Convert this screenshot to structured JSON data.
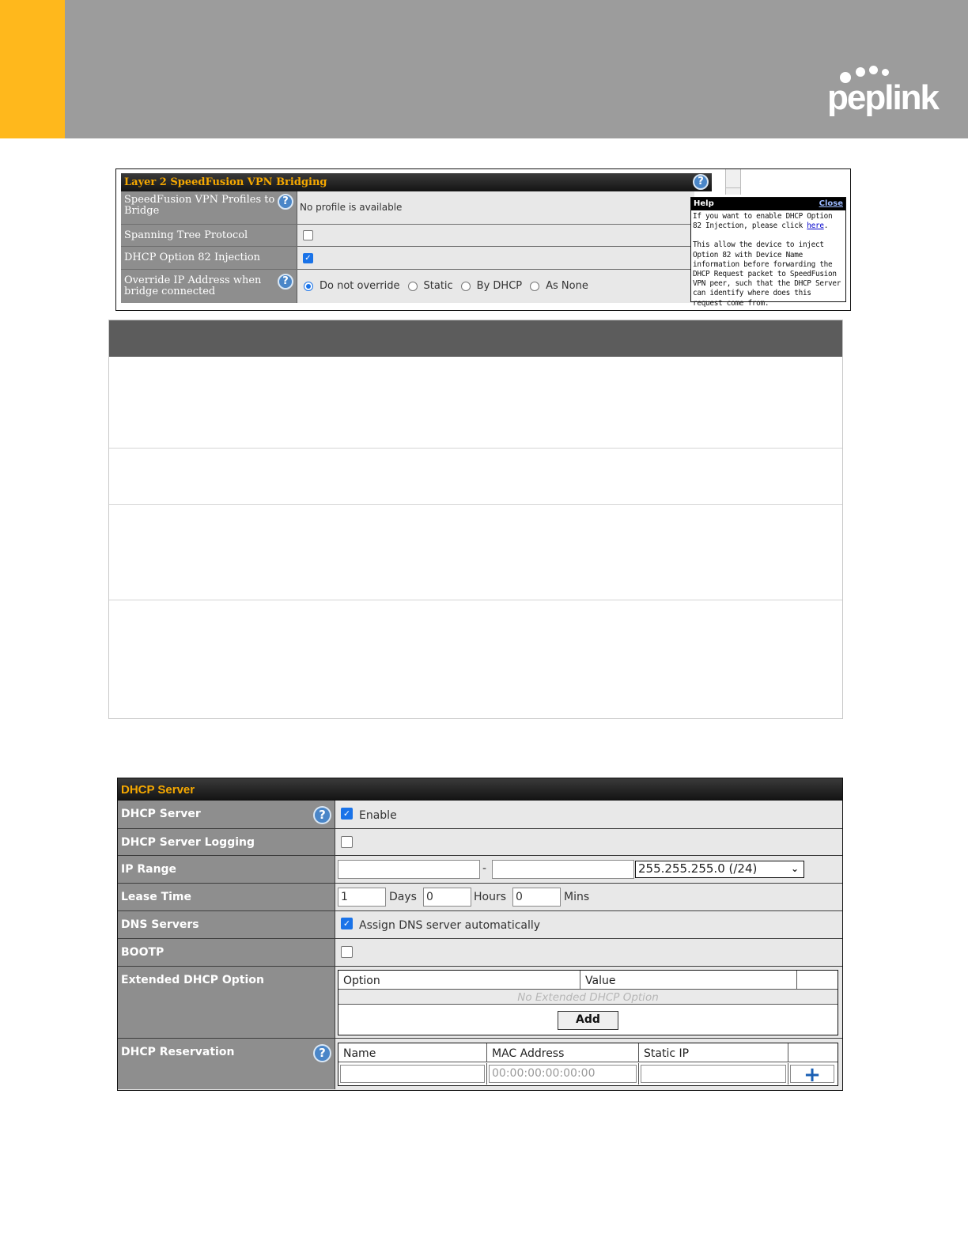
{
  "brand": {
    "logo_text": "peplink",
    "accent_color": "#ffb81c",
    "band_color": "#9c9c9c"
  },
  "l2_bridging": {
    "title": "Layer 2 SpeedFusion VPN Bridging",
    "rows": [
      {
        "label": "SpeedFusion VPN Profiles to Bridge",
        "value": "No profile is available",
        "has_help": true
      },
      {
        "label": "Spanning Tree Protocol",
        "checked": false
      },
      {
        "label": "DHCP Option 82 Injection",
        "checked": true
      },
      {
        "label": "Override IP Address when bridge connected",
        "has_help": true
      }
    ],
    "override_options": [
      {
        "label": "Do not override",
        "selected": true
      },
      {
        "label": "Static",
        "selected": false
      },
      {
        "label": "By DHCP",
        "selected": false
      },
      {
        "label": "As None",
        "selected": false
      }
    ],
    "help": {
      "title": "Help",
      "close": "Close",
      "para1_before": "If you want to enable DHCP Option 82 Injection, please click ",
      "para1_link": "here",
      "para1_after": ".",
      "para2": "This allow the device to inject Option 82 with Device Name information before forwarding the DHCP Request packet to SpeedFusion VPN peer, such that the DHCP Server can identify where does this request come from."
    }
  },
  "dhcp_server": {
    "title": "DHCP Server",
    "server": {
      "label": "DHCP Server",
      "checked": true,
      "text": "Enable"
    },
    "logging": {
      "label": "DHCP Server Logging",
      "checked": false
    },
    "ip_range": {
      "label": "IP Range",
      "start": "",
      "end": "",
      "separator": "-",
      "mask": "255.255.255.0 (/24)"
    },
    "lease": {
      "label": "Lease Time",
      "days": "1",
      "days_unit": "Days",
      "hours": "0",
      "hours_unit": "Hours",
      "mins": "0",
      "mins_unit": "Mins"
    },
    "dns": {
      "label": "DNS Servers",
      "checked": true,
      "text": "Assign DNS server automatically"
    },
    "bootp": {
      "label": "BOOTP",
      "checked": false
    },
    "extended": {
      "label": "Extended DHCP Option",
      "columns": [
        "Option",
        "Value",
        ""
      ],
      "empty_text": "No Extended DHCP Option",
      "add_label": "Add"
    },
    "reservation": {
      "label": "DHCP Reservation",
      "columns": [
        "Name",
        "MAC Address",
        "Static IP",
        ""
      ],
      "name_value": "",
      "mac_placeholder": "00:00:00:00:00:00",
      "static_ip_value": "",
      "add_symbol": "+"
    }
  }
}
